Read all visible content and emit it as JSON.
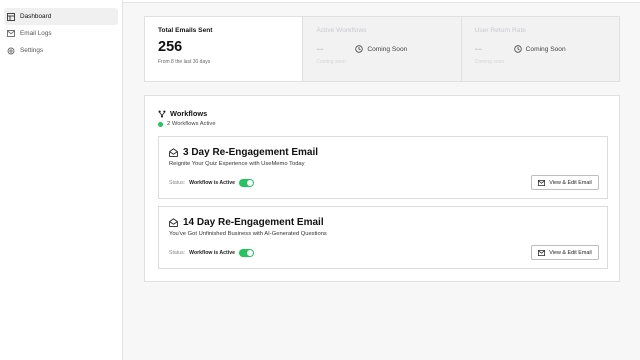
{
  "sidebar": {
    "items": [
      {
        "label": "Dashboard",
        "icon": "dashboard-icon",
        "active": true
      },
      {
        "label": "Email Logs",
        "icon": "mail-icon",
        "active": false
      },
      {
        "label": "Settings",
        "icon": "gear-icon",
        "active": false
      }
    ]
  },
  "stats": {
    "emails": {
      "title": "Total Emails Sent",
      "value": "256",
      "sub": "From 8 the last 30 days"
    },
    "workflows": {
      "title": "Active Workflows",
      "value": "--",
      "soon": "Coming Soon",
      "sub": "Coming soon"
    },
    "return_rate": {
      "title": "User Return Rate",
      "value": "--",
      "soon": "Coming Soon",
      "sub": "Coming soon"
    }
  },
  "workflows": {
    "title": "Workflows",
    "active_count": "2 Workflows Active",
    "cards": [
      {
        "title": "3 Day Re-Engagement Email",
        "subtitle": "Reignite Your Quiz Experience with UseMemo Today",
        "status_label": "Status:",
        "status_value": "Workflow is Active",
        "button": "View & Edit Email"
      },
      {
        "title": "14 Day Re-Engagement Email",
        "subtitle": "You've Got Unfinished Business with AI-Generated Questions",
        "status_label": "Status:",
        "status_value": "Workflow is Active",
        "button": "View & Edit Email"
      }
    ]
  },
  "colors": {
    "accent_green": "#22c55e",
    "border": "#e0e0e3"
  }
}
